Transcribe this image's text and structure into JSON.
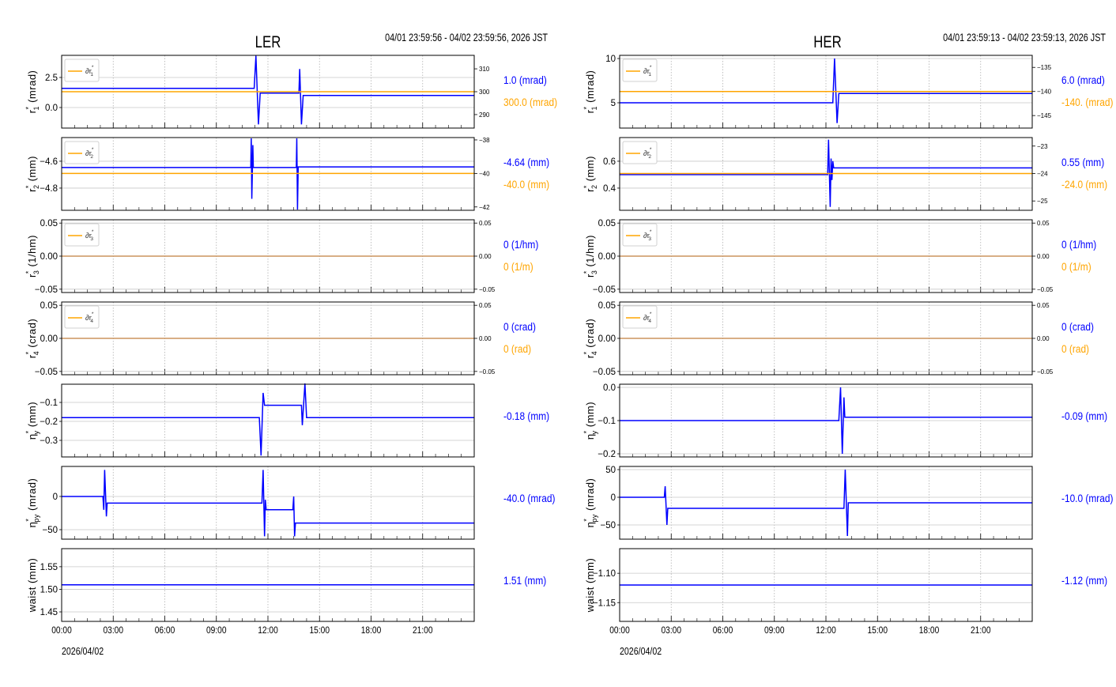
{
  "colors": {
    "blue": "#0000ff",
    "orange": "#ffa500",
    "grid": "#b0b0b0"
  },
  "chart_data": [
    {
      "type": "line",
      "title": "LER",
      "time_range": "04/01 23:59:56 - 04/02 23:59:56, 2026 JST",
      "date_label": "2026/04/02",
      "xlim_hours": [
        0,
        24
      ],
      "xticks": [
        "00:00",
        "03:00",
        "06:00",
        "09:00",
        "12:00",
        "15:00",
        "18:00",
        "21:00"
      ],
      "panels": [
        {
          "ylabel": {
            "base": "r",
            "sup": "*",
            "sub": "1",
            "unit": " (mrad)"
          },
          "ylim": [
            -1.71,
            4.34
          ],
          "yticks": [
            0.0,
            2.5
          ],
          "yticklabels": [
            "0.0",
            "2.5"
          ],
          "right_ylim": [
            284.1,
            315.9
          ],
          "right_yticks": [
            290,
            300,
            310
          ],
          "right_yticklabels": [
            "290",
            "300",
            "310"
          ],
          "legend": {
            "base": "∂r",
            "sup": "*",
            "sub": "1"
          },
          "blue": [
            [
              0,
              1.6
            ],
            [
              11.2,
              1.6
            ],
            [
              11.3,
              4.3
            ],
            [
              11.45,
              -1.4
            ],
            [
              11.55,
              1.2
            ],
            [
              13.8,
              1.2
            ],
            [
              13.85,
              3.2
            ],
            [
              13.95,
              -1.4
            ],
            [
              14.05,
              1.0
            ],
            [
              24,
              1.0
            ]
          ],
          "orange": 300,
          "readout_blue": "1.0 (mrad)",
          "readout_orange": "300.0 (mrad)"
        },
        {
          "ylabel": {
            "base": "r",
            "sup": "*",
            "sub": "2",
            "unit": " (mm)"
          },
          "ylim": [
            -4.965,
            -4.424
          ],
          "yticks": [
            -4.8,
            -4.6
          ],
          "yticklabels": [
            "−4.8",
            "−4.6"
          ],
          "right_ylim": [
            -42.2,
            -37.86
          ],
          "right_yticks": [
            -42,
            -40,
            -38
          ],
          "right_yticklabels": [
            "−42",
            "−40",
            "−38"
          ],
          "legend": {
            "base": "∂r",
            "sup": "*",
            "sub": "2"
          },
          "blue": [
            [
              0,
              -4.647
            ],
            [
              11.0,
              -4.647
            ],
            [
              11.03,
              -4.43
            ],
            [
              11.06,
              -4.88
            ],
            [
              11.1,
              -4.647
            ],
            [
              11.12,
              -4.48
            ],
            [
              11.15,
              -4.647
            ],
            [
              13.65,
              -4.647
            ],
            [
              13.68,
              -4.43
            ],
            [
              13.72,
              -4.96
            ],
            [
              13.76,
              -4.642
            ],
            [
              24,
              -4.642
            ]
          ],
          "orange": -40,
          "readout_blue": "-4.64 (mm)",
          "readout_orange": "-40.0 (mm)"
        },
        {
          "ylabel": {
            "base": "r",
            "sup": "*",
            "sub": "3",
            "unit": " (1/hm)"
          },
          "ylim": [
            -0.055,
            0.055
          ],
          "yticks": [
            -0.05,
            0,
            0.05
          ],
          "yticklabels": [
            "−0.05",
            "0.00",
            "0.05"
          ],
          "right_ylim": [
            -0.055,
            0.055
          ],
          "right_yticks": [
            -0.05,
            0,
            0.05
          ],
          "right_yticklabels": [
            "−0.05",
            "0.00",
            "0.05"
          ],
          "legend": {
            "base": "∂r",
            "sup": "*",
            "sub": "3"
          },
          "blue": [
            [
              0,
              0
            ],
            [
              24,
              0
            ]
          ],
          "orange": 0,
          "readout_blue": "0 (1/hm)",
          "readout_orange": "0 (1/m)"
        },
        {
          "ylabel": {
            "base": "r",
            "sup": "*",
            "sub": "4",
            "unit": " (crad)"
          },
          "ylim": [
            -0.055,
            0.055
          ],
          "yticks": [
            -0.05,
            0,
            0.05
          ],
          "yticklabels": [
            "−0.05",
            "0.00",
            "0.05"
          ],
          "right_ylim": [
            -0.055,
            0.055
          ],
          "right_yticks": [
            -0.05,
            0,
            0.05
          ],
          "right_yticklabels": [
            "−0.05",
            "0.00",
            "0.05"
          ],
          "legend": {
            "base": "∂r",
            "sup": "*",
            "sub": "4"
          },
          "blue": [
            [
              0,
              0
            ],
            [
              24,
              0
            ]
          ],
          "orange": 0,
          "readout_blue": "0 (crad)",
          "readout_orange": "0 (rad)"
        },
        {
          "ylabel": {
            "base": "η",
            "sup": "*",
            "sub": "y",
            "unit": " (mm)"
          },
          "ylim": [
            -0.3875,
            -0.004
          ],
          "yticks": [
            -0.3,
            -0.2,
            -0.1
          ],
          "yticklabels": [
            "−0.3",
            "−0.2",
            "−0.1"
          ],
          "blue": [
            [
              0,
              -0.18
            ],
            [
              11.5,
              -0.18
            ],
            [
              11.6,
              -0.38
            ],
            [
              11.72,
              -0.05
            ],
            [
              11.8,
              -0.115
            ],
            [
              13.95,
              -0.115
            ],
            [
              14.0,
              -0.22
            ],
            [
              14.15,
              0.0
            ],
            [
              14.25,
              -0.18
            ],
            [
              24,
              -0.18
            ]
          ],
          "readout_blue": "-0.18 (mm)"
        },
        {
          "ylabel": {
            "base": "η",
            "sup": "*",
            "sub": "py",
            "unit": " (mrad)"
          },
          "ylim": [
            -64.3,
            45.2
          ],
          "yticks": [
            -50,
            0
          ],
          "yticklabels": [
            "−50",
            "0"
          ],
          "blue": [
            [
              0,
              0
            ],
            [
              2.4,
              0
            ],
            [
              2.45,
              -20
            ],
            [
              2.5,
              40
            ],
            [
              2.6,
              -30
            ],
            [
              2.65,
              -10
            ],
            [
              11.65,
              -10
            ],
            [
              11.72,
              40
            ],
            [
              11.8,
              -60
            ],
            [
              11.85,
              -5
            ],
            [
              11.9,
              -20
            ],
            [
              13.45,
              -20
            ],
            [
              13.5,
              0
            ],
            [
              13.55,
              -60
            ],
            [
              13.6,
              -40
            ],
            [
              24,
              -40
            ]
          ],
          "readout_blue": "-40.0 (mrad)"
        },
        {
          "ylabel": {
            "base": "waist",
            "sup": "",
            "sub": "",
            "unit": " (mm)"
          },
          "ylim": [
            1.429,
            1.59
          ],
          "yticks": [
            1.45,
            1.5,
            1.55
          ],
          "yticklabels": [
            "1.45",
            "1.50",
            "1.55"
          ],
          "blue": [
            [
              0,
              1.51
            ],
            [
              24,
              1.51
            ]
          ],
          "readout_blue": "1.51 (mm)"
        }
      ]
    },
    {
      "type": "line",
      "title": "HER",
      "time_range": "04/01 23:59:13 - 04/02 23:59:13, 2026 JST",
      "date_label": "2026/04/02",
      "xlim_hours": [
        0,
        24
      ],
      "xticks": [
        "00:00",
        "03:00",
        "06:00",
        "09:00",
        "12:00",
        "15:00",
        "18:00",
        "21:00"
      ],
      "panels": [
        {
          "ylabel": {
            "base": "r",
            "sup": "*",
            "sub": "1",
            "unit": " (mrad)"
          },
          "ylim": [
            2.14,
            10.36
          ],
          "yticks": [
            5,
            10
          ],
          "yticklabels": [
            "5",
            "10"
          ],
          "right_ylim": [
            -147.6,
            -132.5
          ],
          "right_yticks": [
            -145,
            -140,
            -135
          ],
          "right_yticklabels": [
            "−145",
            "−140",
            "−135"
          ],
          "legend": {
            "base": "∂r",
            "sup": "*",
            "sub": "1"
          },
          "blue": [
            [
              0,
              5
            ],
            [
              12.4,
              5
            ],
            [
              12.5,
              10
            ],
            [
              12.65,
              2.7
            ],
            [
              12.75,
              6.05
            ],
            [
              24,
              6.05
            ]
          ],
          "orange": -140,
          "readout_blue": "6.0 (mrad)",
          "readout_orange": "-140. (mrad)"
        },
        {
          "ylabel": {
            "base": "r",
            "sup": "*",
            "sub": "2",
            "unit": " (mm)"
          },
          "ylim": [
            0.235,
            0.776
          ],
          "yticks": [
            0.4,
            0.6
          ],
          "yticklabels": [
            "0.4",
            "0.6"
          ],
          "right_ylim": [
            -25.34,
            -22.69
          ],
          "right_yticks": [
            -25,
            -24,
            -23
          ],
          "right_yticklabels": [
            "−25",
            "−24",
            "−23"
          ],
          "legend": {
            "base": "∂r",
            "sup": "*",
            "sub": "2"
          },
          "blue": [
            [
              0,
              0.5
            ],
            [
              12.1,
              0.5
            ],
            [
              12.15,
              0.76
            ],
            [
              12.25,
              0.26
            ],
            [
              12.3,
              0.62
            ],
            [
              12.35,
              0.46
            ],
            [
              12.4,
              0.6
            ],
            [
              12.45,
              0.55
            ],
            [
              24,
              0.55
            ]
          ],
          "orange": -24,
          "readout_blue": "0.55 (mm)",
          "readout_orange": "-24.0 (mm)"
        },
        {
          "ylabel": {
            "base": "r",
            "sup": "*",
            "sub": "3",
            "unit": " (1/hm)"
          },
          "ylim": [
            -0.055,
            0.055
          ],
          "yticks": [
            -0.05,
            0,
            0.05
          ],
          "yticklabels": [
            "−0.05",
            "0.00",
            "0.05"
          ],
          "right_ylim": [
            -0.055,
            0.055
          ],
          "right_yticks": [
            -0.05,
            0,
            0.05
          ],
          "right_yticklabels": [
            "−0.05",
            "0.00",
            "0.05"
          ],
          "legend": {
            "base": "∂r",
            "sup": "*",
            "sub": "3"
          },
          "blue": [
            [
              0,
              0
            ],
            [
              24,
              0
            ]
          ],
          "orange": 0,
          "readout_blue": "0 (1/hm)",
          "readout_orange": "0 (1/m)"
        },
        {
          "ylabel": {
            "base": "r",
            "sup": "*",
            "sub": "4",
            "unit": " (crad)"
          },
          "ylim": [
            -0.055,
            0.055
          ],
          "yticks": [
            -0.05,
            0,
            0.05
          ],
          "yticklabels": [
            "−0.05",
            "0.00",
            "0.05"
          ],
          "right_ylim": [
            -0.055,
            0.055
          ],
          "right_yticks": [
            -0.05,
            0,
            0.05
          ],
          "right_yticklabels": [
            "−0.05",
            "0.00",
            "0.05"
          ],
          "legend": {
            "base": "∂r",
            "sup": "*",
            "sub": "4"
          },
          "blue": [
            [
              0,
              0
            ],
            [
              24,
              0
            ]
          ],
          "orange": 0,
          "readout_blue": "0 (crad)",
          "readout_orange": "0 (rad)"
        },
        {
          "ylabel": {
            "base": "η",
            "sup": "*",
            "sub": "y",
            "unit": " (mm)"
          },
          "ylim": [
            -0.2095,
            0.0095
          ],
          "yticks": [
            -0.2,
            -0.1,
            0.0
          ],
          "yticklabels": [
            "−0.2",
            "−0.1",
            "0.0"
          ],
          "blue": [
            [
              0,
              -0.1
            ],
            [
              12.75,
              -0.1
            ],
            [
              12.85,
              0.0
            ],
            [
              12.95,
              -0.2
            ],
            [
              13.05,
              -0.03
            ],
            [
              13.1,
              -0.09
            ],
            [
              24,
              -0.09
            ]
          ],
          "readout_blue": "-0.09 (mm)"
        },
        {
          "ylabel": {
            "base": "η",
            "sup": "*",
            "sub": "py",
            "unit": " (mrad)"
          },
          "ylim": [
            -75.7,
            55.7
          ],
          "yticks": [
            -50,
            0,
            50
          ],
          "yticklabels": [
            "−50",
            "0",
            "50"
          ],
          "blue": [
            [
              0,
              0
            ],
            [
              2.6,
              0
            ],
            [
              2.65,
              20
            ],
            [
              2.75,
              -50
            ],
            [
              2.8,
              -20
            ],
            [
              13.05,
              -20
            ],
            [
              13.12,
              50
            ],
            [
              13.25,
              -70
            ],
            [
              13.3,
              -10
            ],
            [
              24,
              -10
            ]
          ],
          "readout_blue": "-10.0 (mrad)"
        },
        {
          "ylabel": {
            "base": "waist",
            "sup": "",
            "sub": "",
            "unit": " (mm)"
          },
          "ylim": [
            -1.182,
            -1.058
          ],
          "yticks": [
            -1.15,
            -1.1
          ],
          "yticklabels": [
            "−1.15",
            "−1.10"
          ],
          "blue": [
            [
              0,
              -1.12
            ],
            [
              24,
              -1.12
            ]
          ],
          "readout_blue": "-1.12 (mm)"
        }
      ]
    }
  ]
}
